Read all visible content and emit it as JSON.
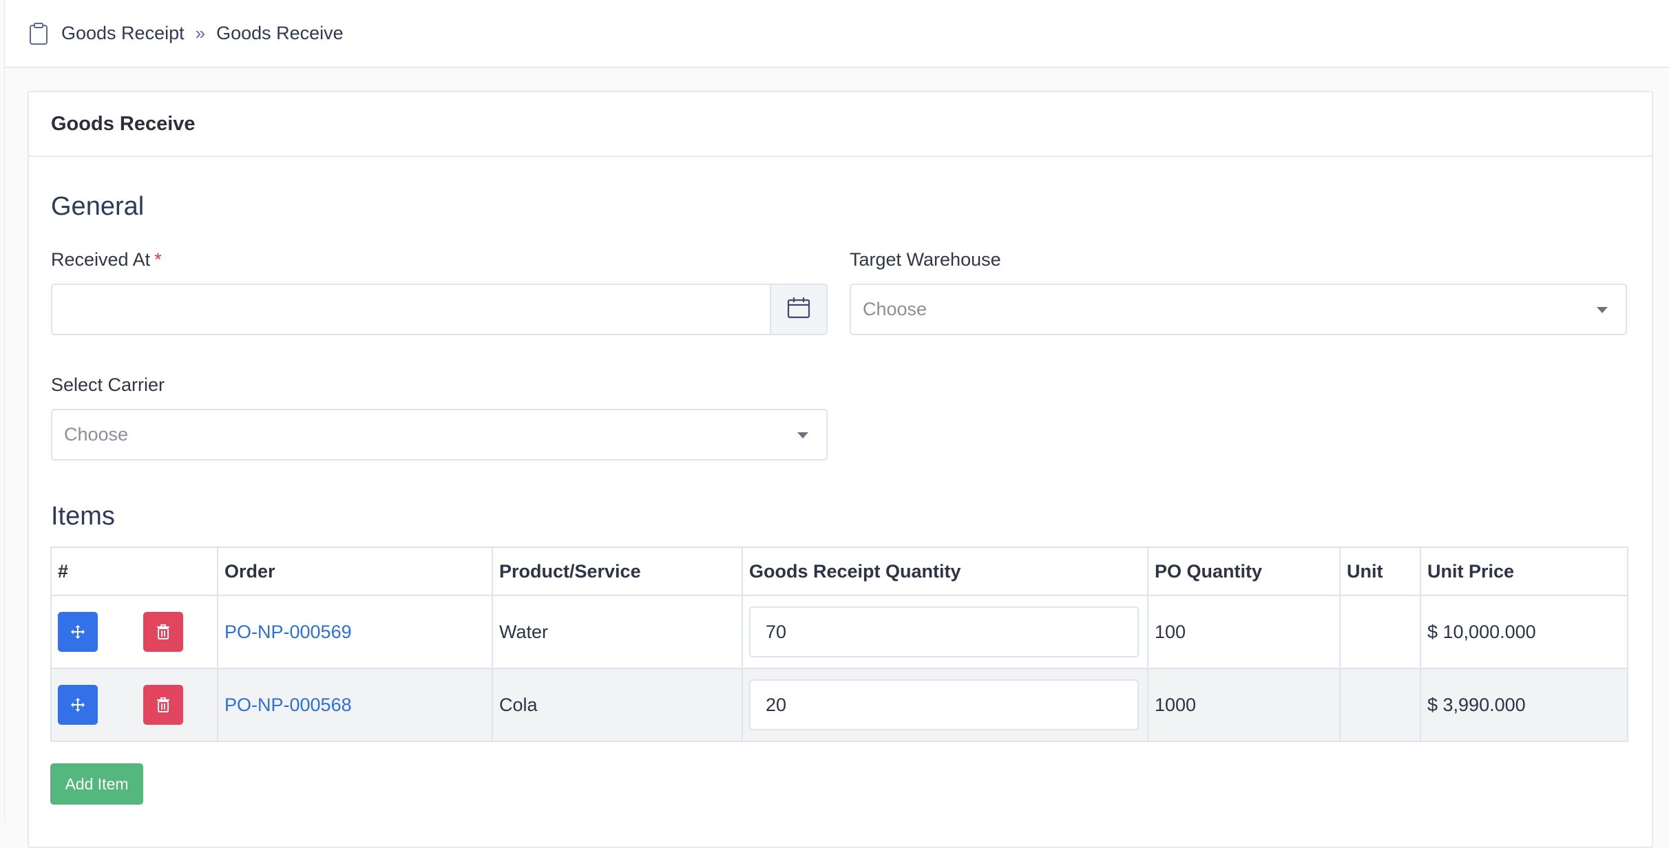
{
  "breadcrumb": {
    "icon": "clipboard-icon",
    "parent": "Goods Receipt",
    "separator": "»",
    "current": "Goods Receive"
  },
  "card": {
    "title": "Goods Receive"
  },
  "general": {
    "section_title": "General",
    "received_at": {
      "label": "Received At",
      "required_mark": "*",
      "value": "",
      "icon": "calendar-icon"
    },
    "target_warehouse": {
      "label": "Target Warehouse",
      "placeholder": "Choose"
    },
    "select_carrier": {
      "label": "Select Carrier",
      "placeholder": "Choose"
    }
  },
  "items": {
    "section_title": "Items",
    "columns": [
      "#",
      "Order",
      "Product/Service",
      "Goods Receipt Quantity",
      "PO Quantity",
      "Unit",
      "Unit Price"
    ],
    "rows": [
      {
        "order": "PO-NP-000569",
        "product": "Water",
        "gr_quantity": "70",
        "po_quantity": "100",
        "unit": "",
        "unit_price": "$ 10,000.000"
      },
      {
        "order": "PO-NP-000568",
        "product": "Cola",
        "gr_quantity": "20",
        "po_quantity": "1000",
        "unit": "",
        "unit_price": "$ 3,990.000"
      }
    ],
    "add_button": "Add Item"
  },
  "colors": {
    "primary": "#3371e8",
    "danger": "#e2465f",
    "success": "#54b77e",
    "link": "#2f6fd9",
    "required": "#e0334d"
  }
}
